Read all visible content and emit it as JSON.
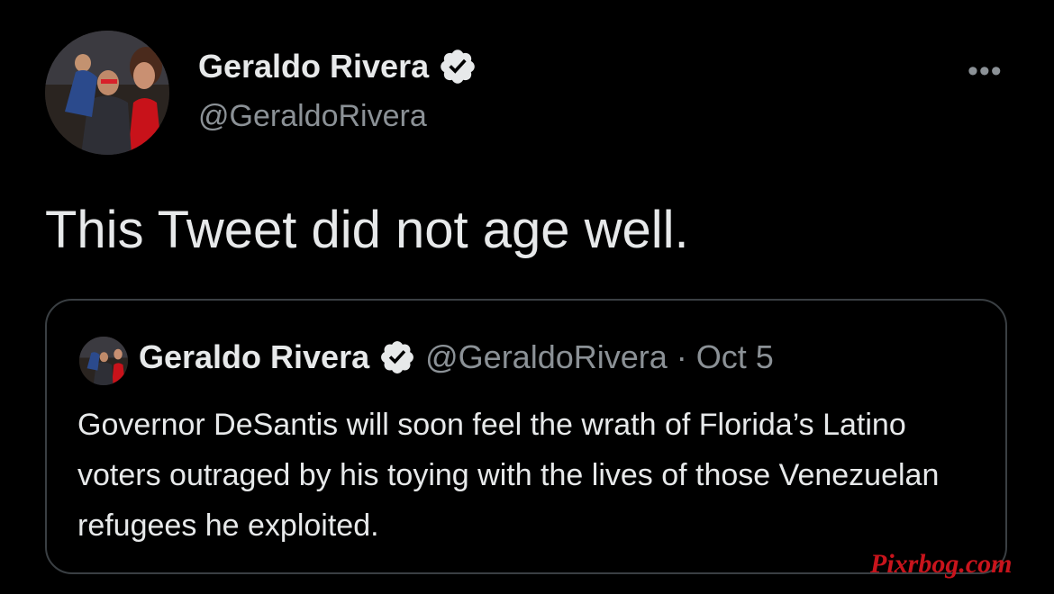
{
  "author": {
    "name": "Geraldo Rivera",
    "handle": "@GeraldoRivera",
    "verified": true,
    "avatar_icon": "profile-photo"
  },
  "more_label": "•••",
  "tweet": {
    "text": "This Tweet did not age well."
  },
  "quoted_tweet": {
    "name": "Geraldo Rivera",
    "handle": "@GeraldoRivera",
    "separator": "·",
    "date": "Oct 5",
    "text": "Governor DeSantis will soon feel the wrath of Florida’s Latino voters outraged by his toying with the lives of those Venezuelan refugees he exploited."
  },
  "watermark": "Pixrbog.com",
  "colors": {
    "background": "#000000",
    "text": "#e7e9ea",
    "secondary": "#8b9196",
    "border": "#3a3f43",
    "badge": "#e7e9ea",
    "watermark": "#c8141c"
  }
}
